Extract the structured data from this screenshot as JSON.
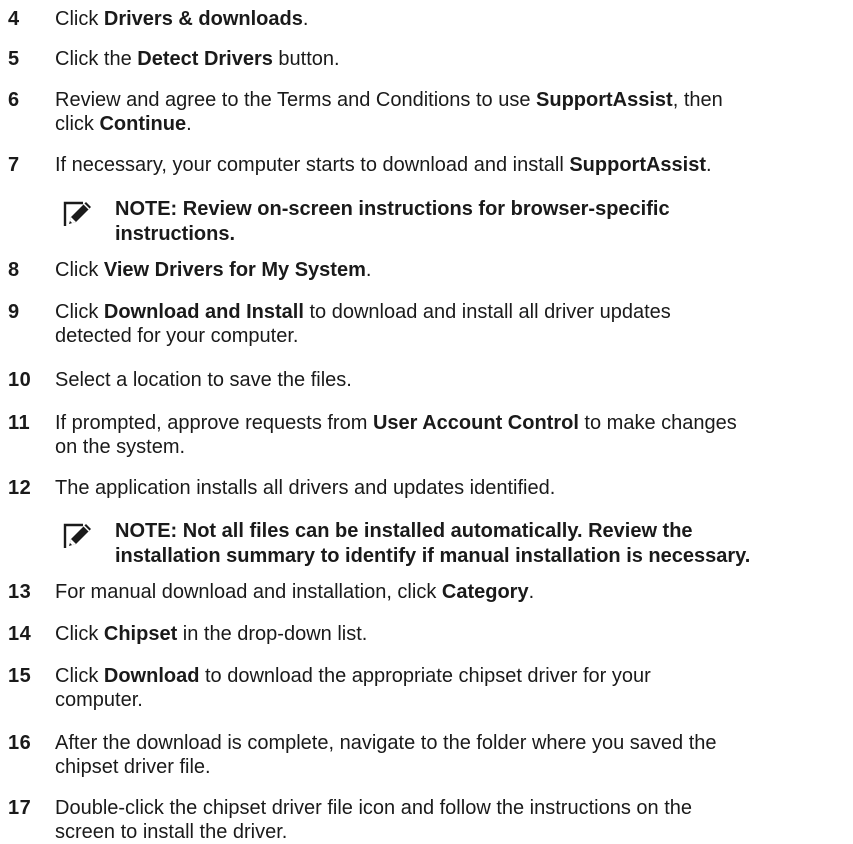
{
  "steps": [
    {
      "number": "4",
      "parts": [
        {
          "t": "Click "
        },
        {
          "t": "Drivers & downloads",
          "b": true
        },
        {
          "t": "."
        }
      ]
    },
    {
      "number": "5",
      "parts": [
        {
          "t": "Click the "
        },
        {
          "t": "Detect Drivers",
          "b": true
        },
        {
          "t": " button."
        }
      ]
    },
    {
      "number": "6",
      "parts": [
        {
          "t": "Review and agree to the Terms and Conditions to use "
        },
        {
          "t": "SupportAssist",
          "b": true
        },
        {
          "t": ", then"
        },
        {
          "br": true
        },
        {
          "t": "click "
        },
        {
          "t": "Continue",
          "b": true
        },
        {
          "t": "."
        }
      ]
    },
    {
      "number": "7",
      "parts": [
        {
          "t": "If necessary, your computer starts to download and install "
        },
        {
          "t": "SupportAssist",
          "b": true
        },
        {
          "t": "."
        }
      ]
    },
    {
      "number": "8",
      "parts": [
        {
          "t": "Click "
        },
        {
          "t": "View Drivers for My System",
          "b": true
        },
        {
          "t": "."
        }
      ]
    },
    {
      "number": "9",
      "parts": [
        {
          "t": "Click "
        },
        {
          "t": "Download and Install",
          "b": true
        },
        {
          "t": " to download and install all driver updates"
        },
        {
          "br": true
        },
        {
          "t": "detected for your computer."
        }
      ]
    },
    {
      "number": "10",
      "parts": [
        {
          "t": "Select a location to save the files."
        }
      ]
    },
    {
      "number": "11",
      "parts": [
        {
          "t": "If prompted, approve requests from "
        },
        {
          "t": "User Account Control",
          "b": true
        },
        {
          "t": " to make changes"
        },
        {
          "br": true
        },
        {
          "t": "on the system."
        }
      ]
    },
    {
      "number": "12",
      "parts": [
        {
          "t": "The application installs all drivers and updates identified."
        }
      ]
    },
    {
      "number": "13",
      "parts": [
        {
          "t": "For manual download and installation, click "
        },
        {
          "t": "Category",
          "b": true
        },
        {
          "t": "."
        }
      ]
    },
    {
      "number": "14",
      "parts": [
        {
          "t": "Click "
        },
        {
          "t": "Chipset",
          "b": true
        },
        {
          "t": " in the drop-down list."
        }
      ]
    },
    {
      "number": "15",
      "parts": [
        {
          "t": "Click "
        },
        {
          "t": "Download",
          "b": true
        },
        {
          "t": " to download the appropriate chipset driver for your"
        },
        {
          "br": true
        },
        {
          "t": "computer."
        }
      ]
    },
    {
      "number": "16",
      "parts": [
        {
          "t": "After the download is complete, navigate to the folder where you saved the"
        },
        {
          "br": true
        },
        {
          "t": "chipset driver file."
        }
      ]
    },
    {
      "number": "17",
      "parts": [
        {
          "t": "Double-click the chipset driver file icon and follow the instructions on the"
        },
        {
          "br": true
        },
        {
          "t": "screen to install the driver."
        }
      ]
    }
  ],
  "notes": [
    {
      "icon": "pencil-note-icon",
      "lines": [
        "NOTE: Review on-screen instructions for browser-specific",
        "instructions."
      ]
    },
    {
      "icon": "pencil-note-icon",
      "lines": [
        "NOTE: Not all files can be installed automatically. Review the",
        "installation summary to identify if manual installation is necessary."
      ]
    }
  ]
}
